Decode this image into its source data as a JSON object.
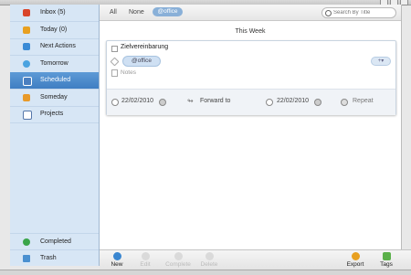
{
  "sidebar": {
    "items": [
      {
        "label": "Inbox (5)",
        "icon": "inbox-icon",
        "color": "#d9452b"
      },
      {
        "label": "Today (0)",
        "icon": "today-icon",
        "color": "#e8a020"
      },
      {
        "label": "Next Actions",
        "icon": "next-actions-icon",
        "color": "#3a8bd6"
      },
      {
        "label": "Tomorrow",
        "icon": "tomorrow-icon",
        "color": "#4aa3e0"
      },
      {
        "label": "Scheduled",
        "icon": "calendar-icon",
        "color": "#4a7fc0"
      },
      {
        "label": "Someday",
        "icon": "someday-icon",
        "color": "#e89a2a"
      },
      {
        "label": "Projects",
        "icon": "projects-icon",
        "color": "#5577aa"
      }
    ],
    "completed": "Completed",
    "trash": "Trash"
  },
  "filters": {
    "all": "All",
    "none": "None",
    "active": "@office"
  },
  "search": {
    "placeholder": "Search By Title"
  },
  "section_title": "This Week",
  "task": {
    "title": "Zielvereinbarung",
    "tag": "@office",
    "tag_add": "+▾",
    "notes_placeholder": "Notes",
    "start_date": "22/02/2010",
    "forward": "Forward to",
    "due_date": "22/02/2010",
    "repeat": "Repeat"
  },
  "toolbar": {
    "new": "New",
    "edit": "Edit",
    "complete": "Complete",
    "delete": "Delete",
    "export": "Export",
    "tags": "Tags"
  },
  "colors": {
    "accent": "#3f7ec2",
    "sidebar_bg": "#d7e6f5",
    "tag_pill": "#89b0d8"
  }
}
